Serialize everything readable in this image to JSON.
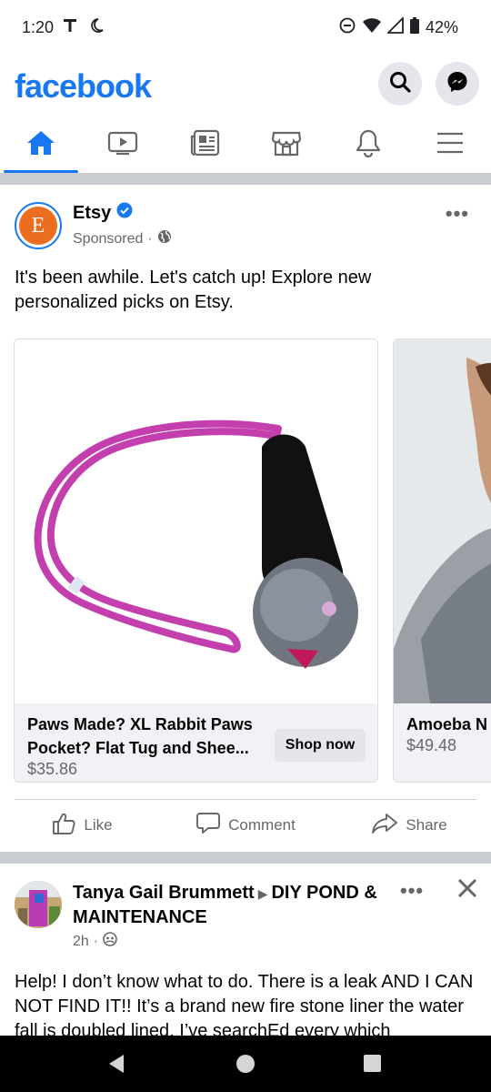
{
  "status_bar": {
    "time": "1:20",
    "battery": "42%"
  },
  "header": {
    "logo": "facebook"
  },
  "tabs": [
    {
      "name": "home",
      "active": true
    },
    {
      "name": "watch",
      "active": false
    },
    {
      "name": "news",
      "active": false
    },
    {
      "name": "marketplace",
      "active": false
    },
    {
      "name": "notifications",
      "active": false
    },
    {
      "name": "menu",
      "active": false
    }
  ],
  "post1": {
    "page_name": "Etsy",
    "avatar_letter": "E",
    "sponsored_label": "Sponsored",
    "sponsored_sep": "·",
    "text": "It's been awhile. Let's catch up! Explore new personalized picks on Etsy.",
    "cards": [
      {
        "title_line1": "Paws Made? XL Rabbit Paws",
        "title_line2": "Pocket? Flat Tug and Shee...",
        "price": "$35.86",
        "button": "Shop now"
      },
      {
        "title_line1": "Amoeba N",
        "price": "$49.48"
      }
    ],
    "actions": {
      "like": "Like",
      "comment": "Comment",
      "share": "Share"
    }
  },
  "post2": {
    "author": "Tanya Gail Brummett",
    "group": "DIY POND & MAINTENANCE",
    "time": "2h",
    "time_sep": "·",
    "text": "Help! I don’t know what to do. There is a leak AND I CAN NOT FIND IT!! It’s a brand new fire stone liner the water fall is doubled lined, I’ve searchEd every which"
  },
  "colors": {
    "brand": "#1877f2",
    "etsy": "#eb6d20"
  }
}
